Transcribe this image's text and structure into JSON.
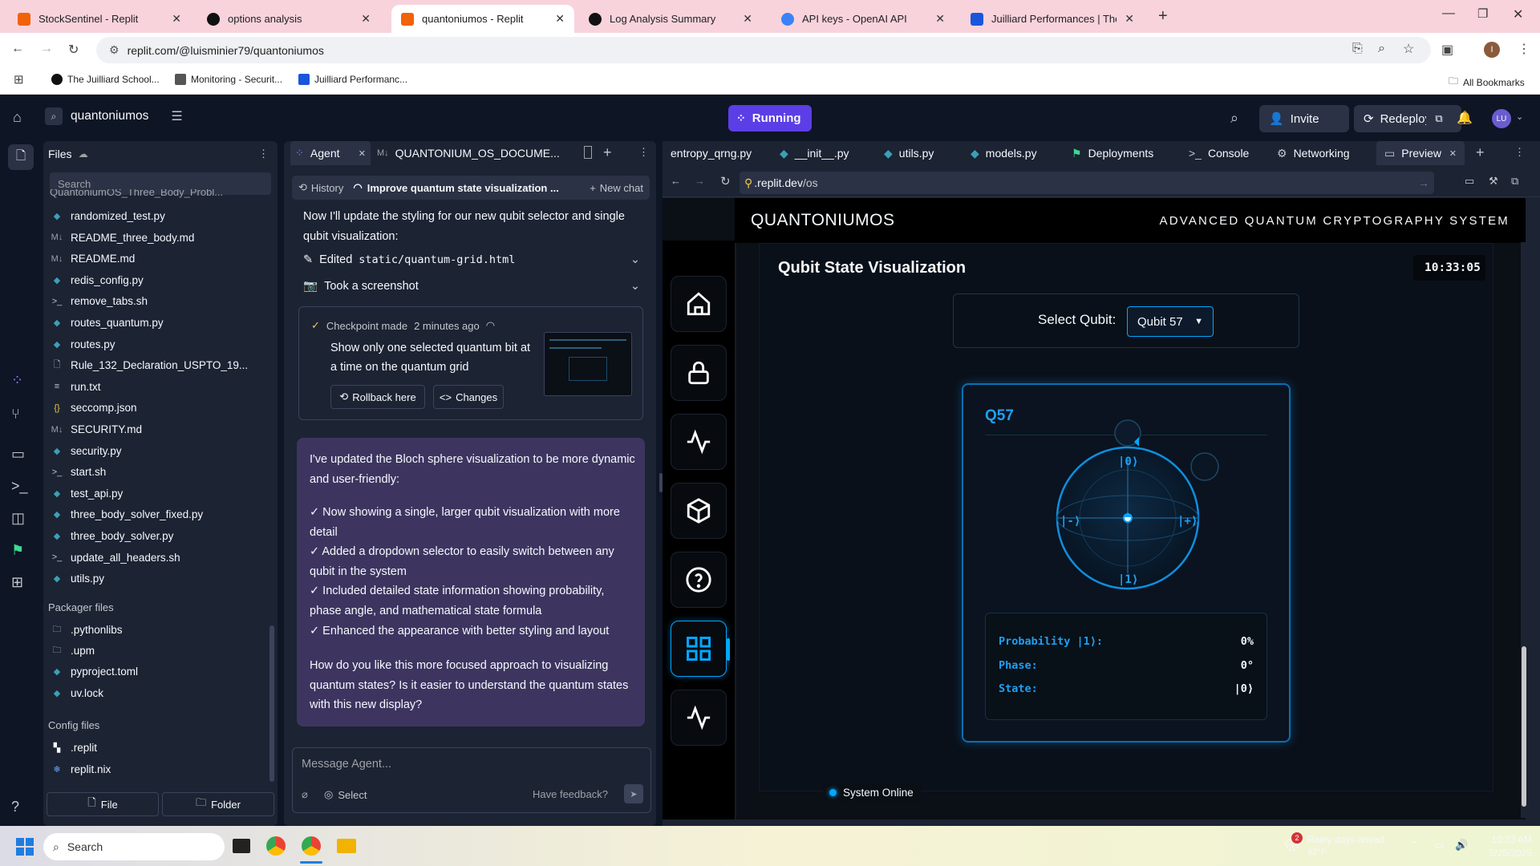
{
  "browser": {
    "tabs": [
      {
        "title": "StockSentinel - Replit",
        "favicon_color": "#f26207"
      },
      {
        "title": "options analysis",
        "favicon_color": "#111111"
      },
      {
        "title": "quantoniumos - Replit",
        "favicon_color": "#f26207"
      },
      {
        "title": "Log Analysis Summary",
        "favicon_color": "#111111"
      },
      {
        "title": "API keys - OpenAI API",
        "favicon_color": "#3b82f6"
      },
      {
        "title": "Juilliard Performances | The Juil",
        "favicon_color": "#1a56db"
      }
    ],
    "url": "replit.com/@luisminier79/quantoniumos",
    "bookmarks": [
      "The Juilliard School...",
      "Monitoring - Securit...",
      "Juilliard Performanc..."
    ],
    "all_bookmarks": "All Bookmarks",
    "profile_initial": "I"
  },
  "replit_header": {
    "repl_name": "quantoniumos",
    "run_status": "Running",
    "invite": "Invite",
    "redeploy": "Redeploy",
    "avatar": "LU"
  },
  "files_panel": {
    "title": "Files",
    "search_placeholder": "Search",
    "truncated_top": "QuantoniumOS_Three_Body_Probl...",
    "items": [
      {
        "name": "randomized_test.py",
        "icon": "python-icon"
      },
      {
        "name": "README_three_body.md",
        "icon": "markdown-icon"
      },
      {
        "name": "README.md",
        "icon": "markdown-icon"
      },
      {
        "name": "redis_config.py",
        "icon": "python-icon"
      },
      {
        "name": "remove_tabs.sh",
        "icon": "shell-icon"
      },
      {
        "name": "routes_quantum.py",
        "icon": "python-icon"
      },
      {
        "name": "routes.py",
        "icon": "python-icon"
      },
      {
        "name": "Rule_132_Declaration_USPTO_19...",
        "icon": "file-icon"
      },
      {
        "name": "run.txt",
        "icon": "text-icon"
      },
      {
        "name": "seccomp.json",
        "icon": "json-icon"
      },
      {
        "name": "SECURITY.md",
        "icon": "markdown-icon"
      },
      {
        "name": "security.py",
        "icon": "python-icon"
      },
      {
        "name": "start.sh",
        "icon": "shell-icon"
      },
      {
        "name": "test_api.py",
        "icon": "python-icon"
      },
      {
        "name": "three_body_solver_fixed.py",
        "icon": "python-icon"
      },
      {
        "name": "three_body_solver.py",
        "icon": "python-icon"
      },
      {
        "name": "update_all_headers.sh",
        "icon": "shell-icon"
      },
      {
        "name": "utils.py",
        "icon": "python-icon"
      }
    ],
    "packager_title": "Packager files",
    "packager_items": [
      {
        "name": ".pythonlibs",
        "icon": "folder-icon"
      },
      {
        "name": ".upm",
        "icon": "folder-icon"
      },
      {
        "name": "pyproject.toml",
        "icon": "python-icon"
      },
      {
        "name": "uv.lock",
        "icon": "python-icon"
      }
    ],
    "config_title": "Config files",
    "config_items": [
      {
        "name": ".replit",
        "icon": "replit-icon"
      },
      {
        "name": "replit.nix",
        "icon": "nix-icon"
      }
    ],
    "new_file": "File",
    "new_folder": "Folder"
  },
  "agent_panel": {
    "tab_agent": "Agent",
    "tab_doc": "QUANTONIUM_OS_DOCUME...",
    "history": "History",
    "chat_title": "Improve quantum state visualization ...",
    "new_chat": "New chat",
    "intro": "Now I'll update the styling for our new qubit selector and single qubit visualization:",
    "edited_label": "Edited",
    "edited_file": "static/quantum-grid.html",
    "screenshot_label": "Took a screenshot",
    "checkpoint_label": "Checkpoint made",
    "checkpoint_time": "2 minutes ago",
    "checkpoint_text": "Show only one selected quantum bit at a time on the quantum grid",
    "rollback": "Rollback here",
    "changes": "Changes",
    "response_intro": "I've updated the Bloch sphere visualization to be more dynamic and user-friendly:",
    "bullets": [
      "✓ Now showing a single, larger qubit visualization with more detail",
      "✓ Added a dropdown selector to easily switch between any qubit in the system",
      "✓ Included detailed state information showing probability, phase angle, and mathematical state formula",
      "✓ Enhanced the appearance with better styling and layout"
    ],
    "question": "How do you like this more focused approach to visualizing quantum states? Is it easier to understand the quantum states with this new display?",
    "message_placeholder": "Message Agent...",
    "select": "Select",
    "feedback": "Have feedback?"
  },
  "file_tabs": [
    "entropy_qrng.py",
    "__init__.py",
    "utils.py",
    "models.py",
    "Deployments",
    "Console",
    "Networking",
    "Preview"
  ],
  "preview_url_prefix": ".replit.dev",
  "preview_url_path": "/os",
  "app": {
    "brand": "QUANTONIUMOS",
    "tagline": "ADVANCED QUANTUM CRYPTOGRAPHY SYSTEM",
    "section_title": "Qubit State Visualization",
    "clock": "10:33:05",
    "select_label": "Select Qubit:",
    "selected_qubit": "Qubit 57",
    "qubit_id": "Q57",
    "ket_zero": "|0⟩",
    "ket_one": "|1⟩",
    "ket_plus": "|+⟩",
    "ket_minus": "|-⟩",
    "probability_label": "Probability |1⟩:",
    "probability_value": "0%",
    "phase_label": "Phase:",
    "phase_value": "0°",
    "state_label": "State:",
    "state_value": "|0⟩",
    "system_status": "System Online",
    "accent_color": "#00a8ff"
  },
  "taskbar": {
    "search": "Search",
    "weather_title": "Rainy days ahead",
    "weather_temp": "62°F",
    "weather_badge": "2",
    "time": "10:33 AM",
    "date": "5/25/2025"
  }
}
